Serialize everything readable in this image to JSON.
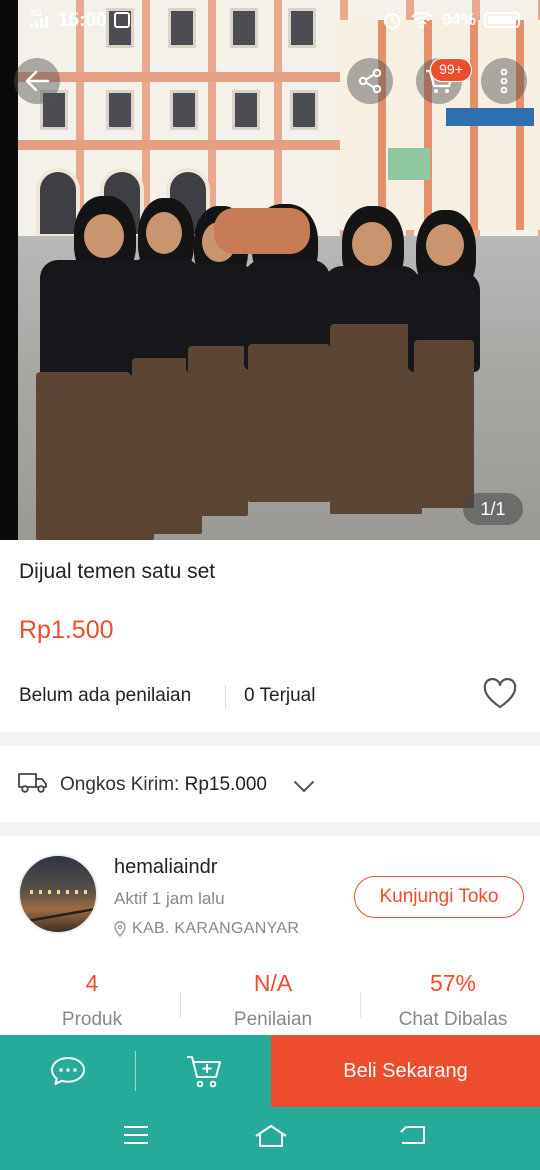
{
  "status_bar": {
    "network": "4G",
    "time": "15:00",
    "battery": "94%"
  },
  "photo": {
    "counter": "1/1"
  },
  "header": {
    "cart_badge": "99+",
    "icons": [
      "back-arrow-icon",
      "share-icon",
      "cart-icon",
      "more-vertical-icon"
    ]
  },
  "product": {
    "title": "Dijual temen satu set",
    "price": "Rp1.500",
    "rating_text": "Belum ada penilaian",
    "sold_text": "0 Terjual"
  },
  "shipping": {
    "label": "Ongkos Kirim:",
    "value": "Rp15.000"
  },
  "shop": {
    "name": "hemaliaindr",
    "active_status": "Aktif 1 jam lalu",
    "location": "KAB. KARANGANYAR",
    "visit_button": "Kunjungi Toko",
    "stats": [
      {
        "value": "4",
        "label": "Produk"
      },
      {
        "value": "N/A",
        "label": "Penilaian"
      },
      {
        "value": "57%",
        "label": "Chat Dibalas"
      }
    ]
  },
  "action_bar": {
    "buy_now": "Beli Sekarang"
  },
  "colors": {
    "accent": "#ee4d2d",
    "teal": "#26aa99"
  }
}
